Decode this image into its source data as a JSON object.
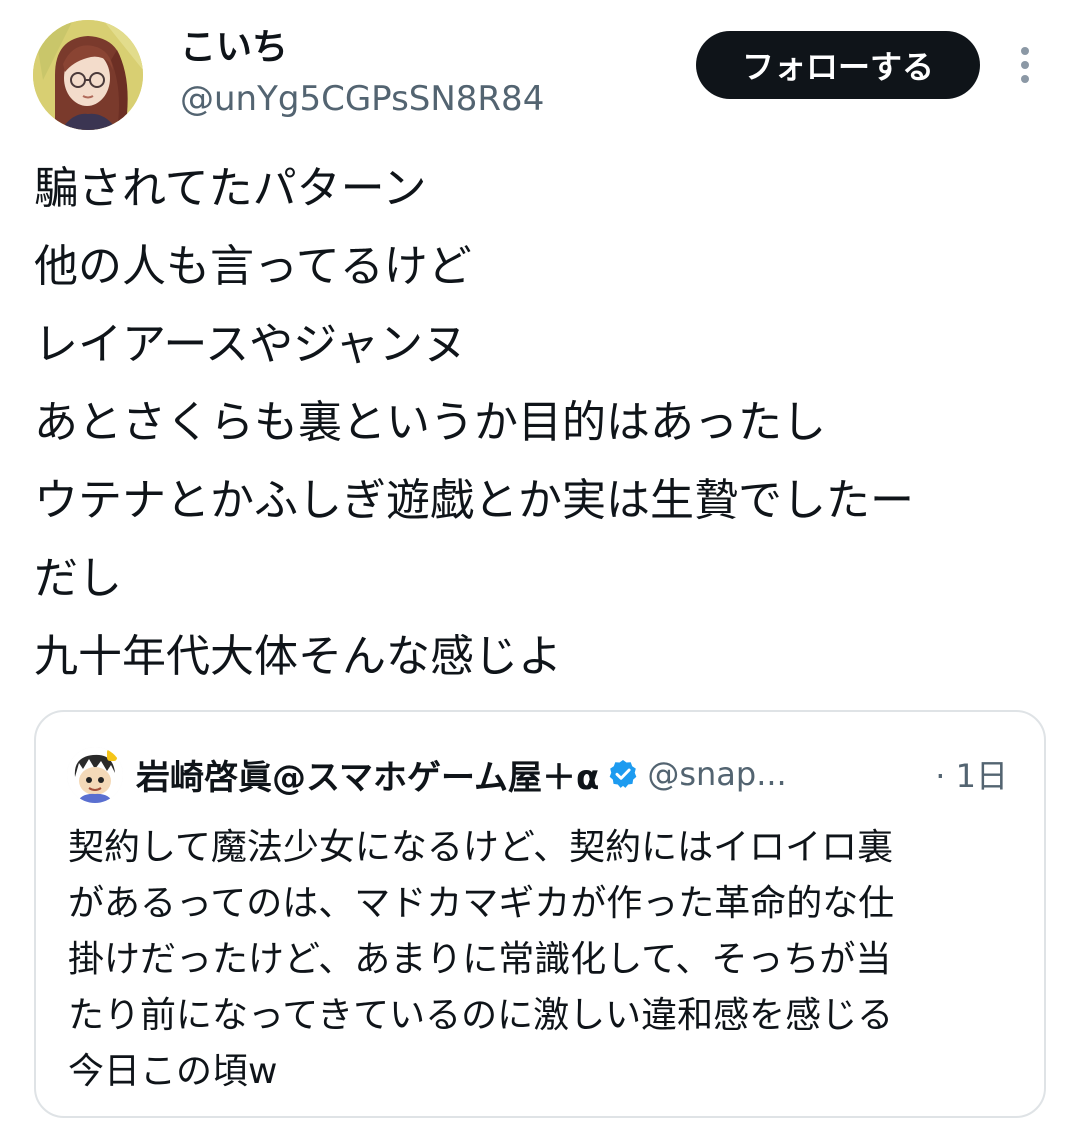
{
  "author": {
    "display_name": "こいち",
    "handle": "@unYg5CGPsSN8R84",
    "avatar_icon": "user-avatar-anime-girl-icon"
  },
  "follow_button_label": "フォローする",
  "more_icon": "more-vertical-icon",
  "tweet_lines": [
    "騙されてたパターン",
    "他の人も言ってるけど",
    "レイアースやジャンヌ",
    "あとさくらも裏というか目的はあったし",
    "ウテナとかふしぎ遊戯とか実は生贄でしたー",
    "だし",
    "九十年代大体そんな感じよ"
  ],
  "quote": {
    "display_name": "岩崎啓眞@スマホゲーム屋＋α",
    "handle": "@snap...",
    "time": "· 1日",
    "verified_icon": "verified-badge-icon",
    "lines": [
      "契約して魔法少女になるけど、契約にはイロイロ裏",
      "があるってのは、マドカマギカが作った革命的な仕",
      "掛けだったけど、あまりに常識化して、そっちが当",
      "たり前になってきているのに激しい違和感を感じる",
      "今日この頃w"
    ]
  },
  "colors": {
    "text_primary": "#0f1419",
    "text_secondary": "#536471",
    "button_bg": "#0f1419",
    "verified_blue": "#1d9bf0",
    "card_border": "#dfe3e6"
  }
}
